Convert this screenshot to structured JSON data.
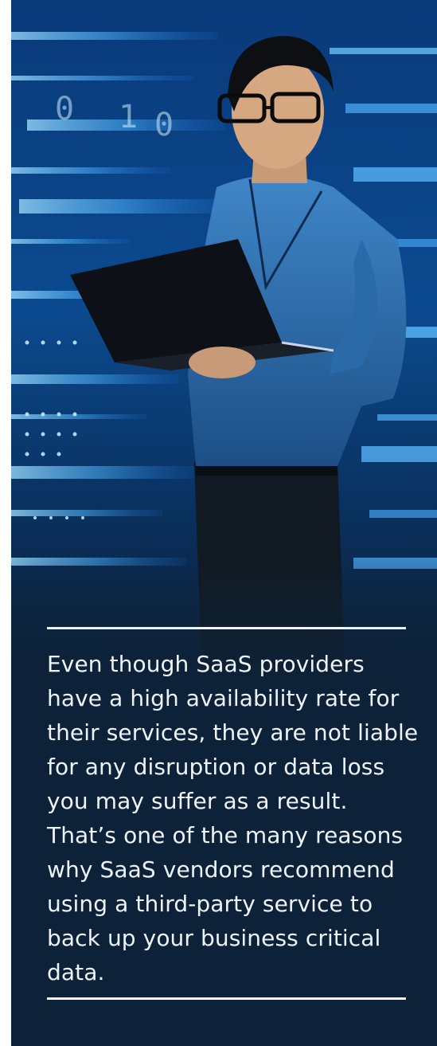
{
  "hero_image": {
    "description_icon": "person-with-laptop-datacenter-image"
  },
  "quote": {
    "text": "Even though SaaS providers have a high availability rate for their services, they are not liable for any disruption or data loss you may suffer as a result. That’s one of the many reasons why SaaS vendors recommend using a third-party service to back up your business critical data."
  },
  "colors": {
    "panel_background": "#0d2238",
    "text": "#eef3f8",
    "divider": "#f2f5f8",
    "accent_blue": "#3fa6ff"
  }
}
